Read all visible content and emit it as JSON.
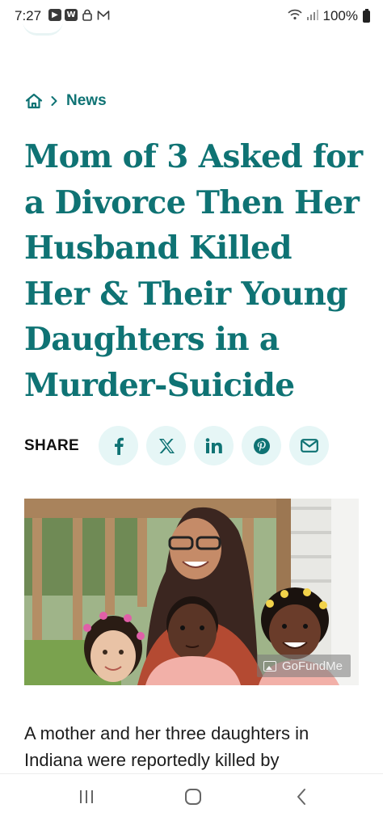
{
  "status_bar": {
    "time": "7:27",
    "left_icons": [
      "youtube-icon",
      "w-icon",
      "lock-icon",
      "mail-icon"
    ],
    "battery": "100%"
  },
  "breadcrumb": {
    "home_icon": "home-icon",
    "section": "News"
  },
  "article": {
    "title": "Mom of 3 Asked for a Divorce Then Her Husband Killed Her & Their Young Daughters in a Murder-Suicide",
    "share_label": "SHARE",
    "share_buttons": [
      "facebook-icon",
      "x-icon",
      "linkedin-icon",
      "pinterest-icon",
      "email-icon"
    ],
    "image_credit": "GoFundMe",
    "body": "A mother and her three daughters in Indiana were reportedly killed by"
  },
  "nav": {
    "buttons": [
      "recents",
      "home",
      "back"
    ]
  },
  "colors": {
    "accent": "#0f7374",
    "share_bg": "#e6f6f6"
  }
}
